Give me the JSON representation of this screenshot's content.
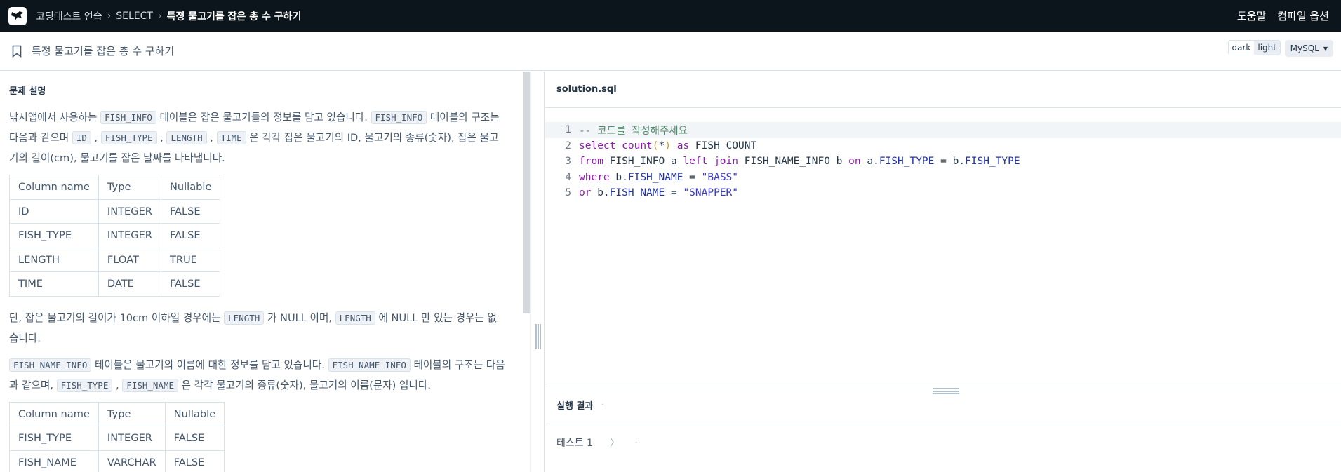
{
  "nav": {
    "crumbs": [
      "코딩테스트 연습",
      "SELECT",
      "특정 물고기를 잡은 총 수 구하기"
    ],
    "help": "도움말",
    "compile_options": "컴파일 옵션"
  },
  "header": {
    "title": "특정 물고기를 잡은 총 수 구하기",
    "theme_dark": "dark",
    "theme_light": "light",
    "language": "MySQL"
  },
  "problem": {
    "heading": "문제 설명",
    "p1": {
      "a": "낚시앱에서 사용하는 ",
      "code1": "FISH_INFO",
      "b": " 테이블은 잡은 물고기들의 정보를 담고 있습니다. ",
      "code2": "FISH_INFO",
      "c": " 테이블의 구조는 다음과 같으며 ",
      "code3": "ID",
      "d": " , ",
      "code4": "FISH_TYPE",
      "e": " , ",
      "code5": "LENGTH",
      "f": " , ",
      "code6": "TIME",
      "g": " 은 각각 잡은 물고기의 ID, 물고기의 종류(숫자), 잡은 물고기의 길이(cm), 물고기를 잡은 날짜를 나타냅니다."
    },
    "table1": {
      "headers": [
        "Column name",
        "Type",
        "Nullable"
      ],
      "rows": [
        [
          "ID",
          "INTEGER",
          "FALSE"
        ],
        [
          "FISH_TYPE",
          "INTEGER",
          "FALSE"
        ],
        [
          "LENGTH",
          "FLOAT",
          "TRUE"
        ],
        [
          "TIME",
          "DATE",
          "FALSE"
        ]
      ]
    },
    "p2": {
      "a": "단, 잡은 물고기의 길이가 10cm 이하일 경우에는 ",
      "code1": "LENGTH",
      "b": " 가 NULL 이며, ",
      "code2": "LENGTH",
      "c": " 에 NULL 만 있는 경우는 없습니다."
    },
    "p3": {
      "code1": "FISH_NAME_INFO",
      "a": " 테이블은 물고기의 이름에 대한 정보를 담고 있습니다. ",
      "code2": "FISH_NAME_INFO",
      "b": " 테이블의 구조는 다음과 같으며, ",
      "code3": "FISH_TYPE",
      "c": " , ",
      "code4": "FISH_NAME",
      "d": " 은 각각 물고기의 종류(숫자), 물고기의 이름(문자) 입니다."
    },
    "table2": {
      "headers": [
        "Column name",
        "Type",
        "Nullable"
      ],
      "rows": [
        [
          "FISH_TYPE",
          "INTEGER",
          "FALSE"
        ],
        [
          "FISH_NAME",
          "VARCHAR",
          "FALSE"
        ]
      ]
    }
  },
  "editor": {
    "filename": "solution.sql",
    "lines": [
      {
        "n": "1",
        "parts": [
          {
            "t": "-- 코드를 작성해주세요",
            "k": "com"
          }
        ]
      },
      {
        "n": "2",
        "parts": [
          {
            "t": "select",
            "k": "kw"
          },
          {
            "t": " ",
            "k": ""
          },
          {
            "t": "count",
            "k": "fn"
          },
          {
            "t": "(",
            "k": "paren"
          },
          {
            "t": "*",
            "k": ""
          },
          {
            "t": ")",
            "k": "paren"
          },
          {
            "t": " ",
            "k": ""
          },
          {
            "t": "as",
            "k": "kw"
          },
          {
            "t": " FISH_COUNT",
            "k": ""
          }
        ]
      },
      {
        "n": "3",
        "parts": [
          {
            "t": "from",
            "k": "kw"
          },
          {
            "t": " FISH_INFO a ",
            "k": ""
          },
          {
            "t": "left join",
            "k": "kw"
          },
          {
            "t": " FISH_NAME_INFO b ",
            "k": ""
          },
          {
            "t": "on",
            "k": "kw"
          },
          {
            "t": " a.",
            "k": ""
          },
          {
            "t": "FISH_TYPE",
            "k": "col"
          },
          {
            "t": " = b.",
            "k": ""
          },
          {
            "t": "FISH_TYPE",
            "k": "col"
          }
        ]
      },
      {
        "n": "4",
        "parts": [
          {
            "t": "where",
            "k": "kw"
          },
          {
            "t": " b.",
            "k": ""
          },
          {
            "t": "FISH_NAME",
            "k": "col"
          },
          {
            "t": " = ",
            "k": ""
          },
          {
            "t": "\"BASS\"",
            "k": "str"
          }
        ]
      },
      {
        "n": "5",
        "parts": [
          {
            "t": "or",
            "k": "kw"
          },
          {
            "t": " b.",
            "k": ""
          },
          {
            "t": "FISH_NAME",
            "k": "col"
          },
          {
            "t": " = ",
            "k": ""
          },
          {
            "t": "\"SNAPPER\"",
            "k": "str"
          }
        ]
      }
    ]
  },
  "result": {
    "heading": "실행 결과",
    "dot": "·",
    "test_label": "테스트 1",
    "chevron": "〉"
  },
  "colors": {
    "nav_bg": "#0c151c",
    "keyword": "#8b1fa8",
    "comment": "#558b6e",
    "string": "#3a3ac9"
  }
}
